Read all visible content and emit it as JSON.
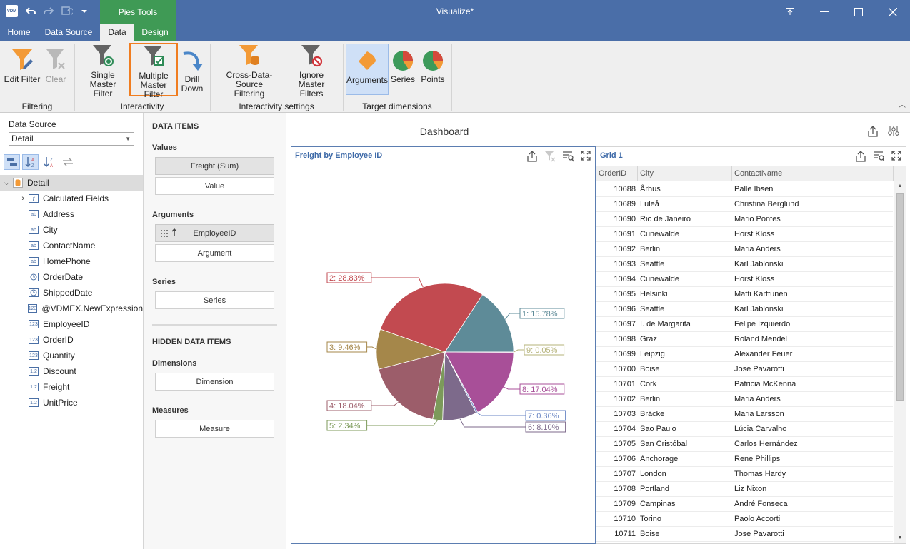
{
  "window": {
    "title": "Visualize*",
    "context_tab": "Pies Tools",
    "app_icon_text": "VDM"
  },
  "menu": {
    "tabs": [
      "Home",
      "Data Source",
      "Data",
      "Design"
    ],
    "active": "Data"
  },
  "ribbon": {
    "buttons": {
      "edit_filter": "Edit Filter",
      "clear": "Clear",
      "single_master_filter_1": "Single Master",
      "single_master_filter_2": "Filter",
      "multiple_master_filter_1": "Multiple",
      "multiple_master_filter_2": "Master Filter",
      "drill_down_1": "Drill",
      "drill_down_2": "Down",
      "cross_ds_1": "Cross-Data-Source",
      "cross_ds_2": "Filtering",
      "ignore_mf_1": "Ignore Master",
      "ignore_mf_2": "Filters",
      "arguments": "Arguments",
      "series": "Series",
      "points": "Points"
    },
    "groups": {
      "filtering": "Filtering",
      "interactivity": "Interactivity",
      "interactivity_settings": "Interactivity settings",
      "target_dimensions": "Target dimensions"
    }
  },
  "data_source": {
    "label": "Data Source",
    "selected": "Detail",
    "root": "Detail",
    "fields": [
      {
        "name": "Calculated Fields",
        "type": "f"
      },
      {
        "name": "Address",
        "type": "ab"
      },
      {
        "name": "City",
        "type": "ab"
      },
      {
        "name": "ContactName",
        "type": "ab"
      },
      {
        "name": "HomePhone",
        "type": "ab"
      },
      {
        "name": "OrderDate",
        "type": "clock"
      },
      {
        "name": "ShippedDate",
        "type": "clock"
      },
      {
        "name": "@VDMEX.NewExpression",
        "type": "123"
      },
      {
        "name": "EmployeeID",
        "type": "123"
      },
      {
        "name": "OrderID",
        "type": "123"
      },
      {
        "name": "Quantity",
        "type": "123"
      },
      {
        "name": "Discount",
        "type": "1.2"
      },
      {
        "name": "Freight",
        "type": "1.2"
      },
      {
        "name": "UnitPrice",
        "type": "1.2"
      }
    ]
  },
  "data_items": {
    "header": "DATA ITEMS",
    "values_label": "Values",
    "values_item": "Freight (Sum)",
    "values_placeholder": "Value",
    "arguments_label": "Arguments",
    "arguments_item": "EmployeeID",
    "arguments_placeholder": "Argument",
    "series_label": "Series",
    "series_placeholder": "Series",
    "hidden_header": "HIDDEN DATA ITEMS",
    "dimensions_label": "Dimensions",
    "dimensions_placeholder": "Dimension",
    "measures_label": "Measures",
    "measures_placeholder": "Measure"
  },
  "dashboard": {
    "title": "Dashboard"
  },
  "pie_panel": {
    "caption": "Freight by Employee ID"
  },
  "chart_data": {
    "type": "pie",
    "title": "Freight by Employee ID",
    "categories": [
      "1",
      "2",
      "3",
      "4",
      "5",
      "6",
      "7",
      "8",
      "9"
    ],
    "values": [
      15.78,
      28.83,
      9.46,
      18.04,
      2.34,
      8.1,
      0.36,
      17.04,
      0.05
    ],
    "labels": [
      "1: 15.78%",
      "2: 28.83%",
      "3: 9.46%",
      "4: 18.04%",
      "5: 2.34%",
      "6: 8.10%",
      "7: 0.36%",
      "8: 17.04%",
      "9: 0.05%"
    ],
    "colors": [
      "#5e8b98",
      "#c24a50",
      "#a5874a",
      "#9c5d6a",
      "#7c9a5a",
      "#7d6a8b",
      "#6a86c4",
      "#a84f98",
      "#b5b37a"
    ]
  },
  "grid": {
    "caption": "Grid 1",
    "columns": [
      "OrderID",
      "City",
      "ContactName"
    ],
    "rows": [
      [
        "10688",
        "Århus",
        "Palle Ibsen"
      ],
      [
        "10689",
        "Luleå",
        "Christina Berglund"
      ],
      [
        "10690",
        "Rio de Janeiro",
        "Mario Pontes"
      ],
      [
        "10691",
        "Cunewalde",
        "Horst Kloss"
      ],
      [
        "10692",
        "Berlin",
        "Maria Anders"
      ],
      [
        "10693",
        "Seattle",
        "Karl Jablonski"
      ],
      [
        "10694",
        "Cunewalde",
        "Horst Kloss"
      ],
      [
        "10695",
        "Helsinki",
        "Matti Karttunen"
      ],
      [
        "10696",
        "Seattle",
        "Karl Jablonski"
      ],
      [
        "10697",
        "I. de Margarita",
        "Felipe Izquierdo"
      ],
      [
        "10698",
        "Graz",
        "Roland Mendel"
      ],
      [
        "10699",
        "Leipzig",
        "Alexander Feuer"
      ],
      [
        "10700",
        "Boise",
        "Jose Pavarotti"
      ],
      [
        "10701",
        "Cork",
        "Patricia McKenna"
      ],
      [
        "10702",
        "Berlin",
        "Maria Anders"
      ],
      [
        "10703",
        "Bräcke",
        "Maria Larsson"
      ],
      [
        "10704",
        "Sao Paulo",
        "Lúcia Carvalho"
      ],
      [
        "10705",
        "San Cristóbal",
        "Carlos Hernández"
      ],
      [
        "10706",
        "Anchorage",
        "Rene Phillips"
      ],
      [
        "10707",
        "London",
        "Thomas Hardy"
      ],
      [
        "10708",
        "Portland",
        "Liz Nixon"
      ],
      [
        "10709",
        "Campinas",
        "André Fonseca"
      ],
      [
        "10710",
        "Torino",
        "Paolo Accorti"
      ],
      [
        "10711",
        "Boise",
        "Jose Pavarotti"
      ]
    ]
  }
}
